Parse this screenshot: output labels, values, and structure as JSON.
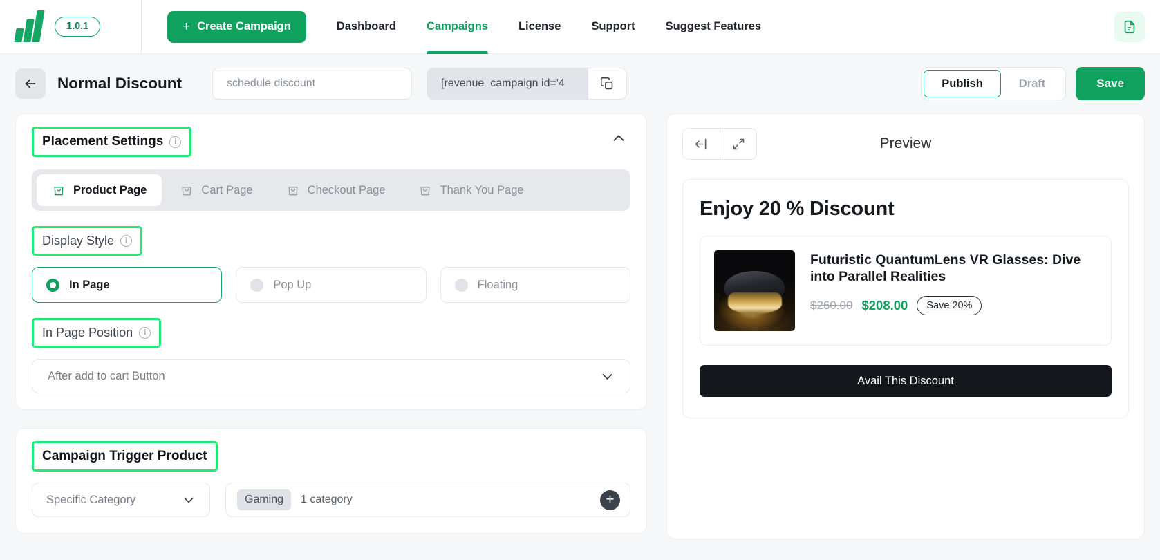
{
  "topbar": {
    "logo_icon": "bar-chart-logo-icon",
    "version": "1.0.1",
    "create_button": {
      "label": "Create Campaign",
      "plus": "+"
    },
    "nav": [
      {
        "label": "Dashboard",
        "active": false
      },
      {
        "label": "Campaigns",
        "active": true
      },
      {
        "label": "License",
        "active": false
      },
      {
        "label": "Support",
        "active": false
      },
      {
        "label": "Suggest Features",
        "active": false
      }
    ],
    "doc_icon": "document-icon"
  },
  "subbar": {
    "back_icon": "arrow-left-icon",
    "title": "Normal Discount",
    "schedule": {
      "placeholder": "schedule discount",
      "value": ""
    },
    "shortcode": {
      "value": "[revenue_campaign id='4",
      "copy_icon": "copy-icon"
    },
    "publish_label": "Publish",
    "draft_label": "Draft",
    "save_label": "Save"
  },
  "placement": {
    "title": "Placement Settings",
    "collapse_icon": "chevron-up-icon",
    "tabs": [
      {
        "label": "Product Page",
        "icon": "shopping-bag-icon",
        "active": true
      },
      {
        "label": "Cart Page",
        "icon": "shopping-bag-icon",
        "active": false
      },
      {
        "label": "Checkout Page",
        "icon": "shopping-bag-icon",
        "active": false
      },
      {
        "label": "Thank You Page",
        "icon": "shopping-bag-icon",
        "active": false
      }
    ],
    "display_style": {
      "title": "Display Style",
      "options": [
        {
          "label": "In Page",
          "selected": true
        },
        {
          "label": "Pop Up",
          "selected": false
        },
        {
          "label": "Floating",
          "selected": false
        }
      ]
    },
    "in_page_position": {
      "title": "In Page Position",
      "value": "After add to cart Button",
      "chevron_icon": "chevron-down-icon"
    }
  },
  "trigger": {
    "title": "Campaign Trigger Product",
    "type_value": "Specific Category",
    "type_chevron_icon": "chevron-down-icon",
    "chip": "Gaming",
    "count_text": "1 category",
    "add_icon": "plus-circle-icon"
  },
  "preview": {
    "collapse_icon": "collapse-left-icon",
    "expand_icon": "expand-fullscreen-icon",
    "title": "Preview",
    "promo_title": "Enjoy 20 % Discount",
    "product": {
      "image_icon": "vr-headset-product-image",
      "name": "Futuristic QuantumLens VR Glasses: Dive into Parallel Realities",
      "old_price": "$260.00",
      "new_price": "$208.00",
      "save_badge": "Save 20%"
    },
    "cta_label": "Avail This Discount"
  },
  "colors": {
    "brand_green": "#11a15f",
    "annotation_green": "#22e877",
    "dark_cta": "#14181d"
  }
}
